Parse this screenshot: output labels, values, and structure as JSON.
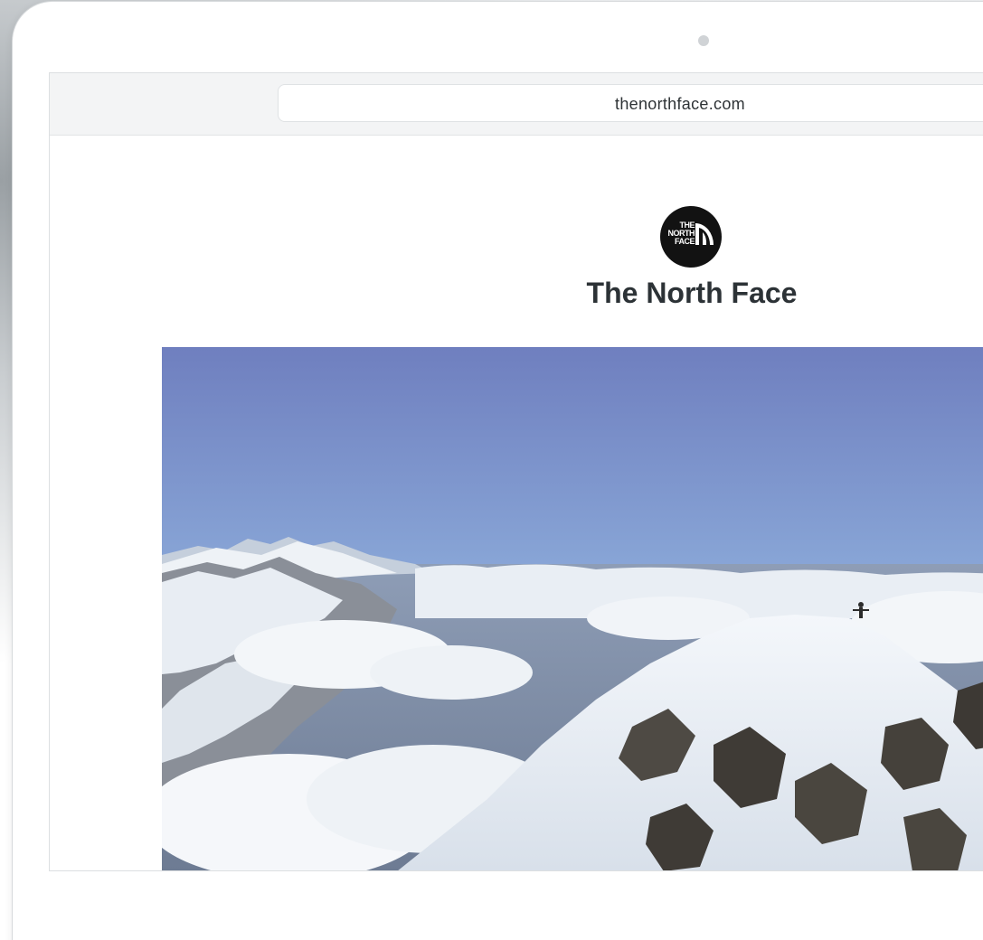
{
  "browser": {
    "url": "thenorthface.com"
  },
  "site": {
    "name": "The North Face",
    "logo_text": [
      "THE",
      "NORTH",
      "FACE"
    ],
    "logo_icon": "the-north-face-half-dome-logo"
  },
  "hero": {
    "image_subject": "mountain-summit-photo"
  },
  "colors": {
    "logo_background": "#121212",
    "title": "#2c3236",
    "browser_bar": "#f3f4f5",
    "sky_top": "#6f7fbf",
    "sky_horizon": "#a9c4e3"
  }
}
